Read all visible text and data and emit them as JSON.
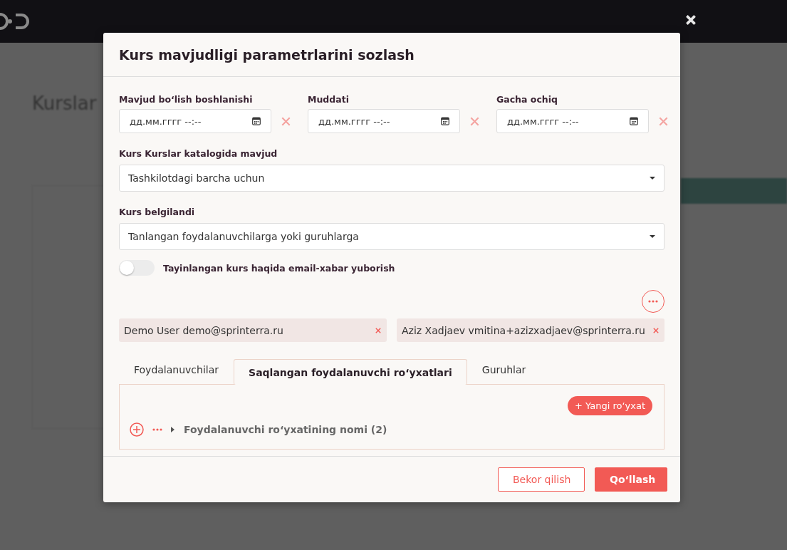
{
  "background": {
    "heading": "Kurslar"
  },
  "dialog": {
    "title": "Kurs mavjudligi parametrlarini sozlash",
    "date_fields": [
      {
        "label": "Mavjud bo‘lish boshlanishi",
        "placeholder": "дд.мм.гггг --:--"
      },
      {
        "label": "Muddati",
        "placeholder": "дд.мм.гггг --:--"
      },
      {
        "label": "Gacha ochiq",
        "placeholder": "дд.мм.гггг --:--"
      }
    ],
    "selects": [
      {
        "label": "Kurs Kurslar katalogida mavjud",
        "value": "Tashkilotdagi barcha uchun"
      },
      {
        "label": "Kurs belgilandi",
        "value": "Tanlangan foydalanuvchilarga yoki guruhlarga"
      }
    ],
    "email_toggle": {
      "label": "Tayinlangan kurs haqida email-xabar yuborish",
      "on": false
    },
    "chips": [
      {
        "text": "Demo User demo@sprinterra.ru"
      },
      {
        "text": "Aziz Xadjaev vmitina+azizxadjaev@sprinterra.ru"
      }
    ],
    "tabs": [
      {
        "label": "Foydalanuvchilar",
        "selected": false
      },
      {
        "label": "Saqlangan foydalanuvchi ro‘yxatlari",
        "selected": true
      },
      {
        "label": "Guruhlar",
        "selected": false
      }
    ],
    "new_list_button": "+ Yangi ro‘yxat",
    "lists": [
      {
        "name": "Foydalanuvchi ro‘yxatining nomi (2)",
        "expanded": false
      }
    ],
    "buttons": [
      {
        "label": "Bekor qilish",
        "kind": "secondary"
      },
      {
        "label": "Qo‘llash",
        "kind": "primary"
      }
    ]
  }
}
